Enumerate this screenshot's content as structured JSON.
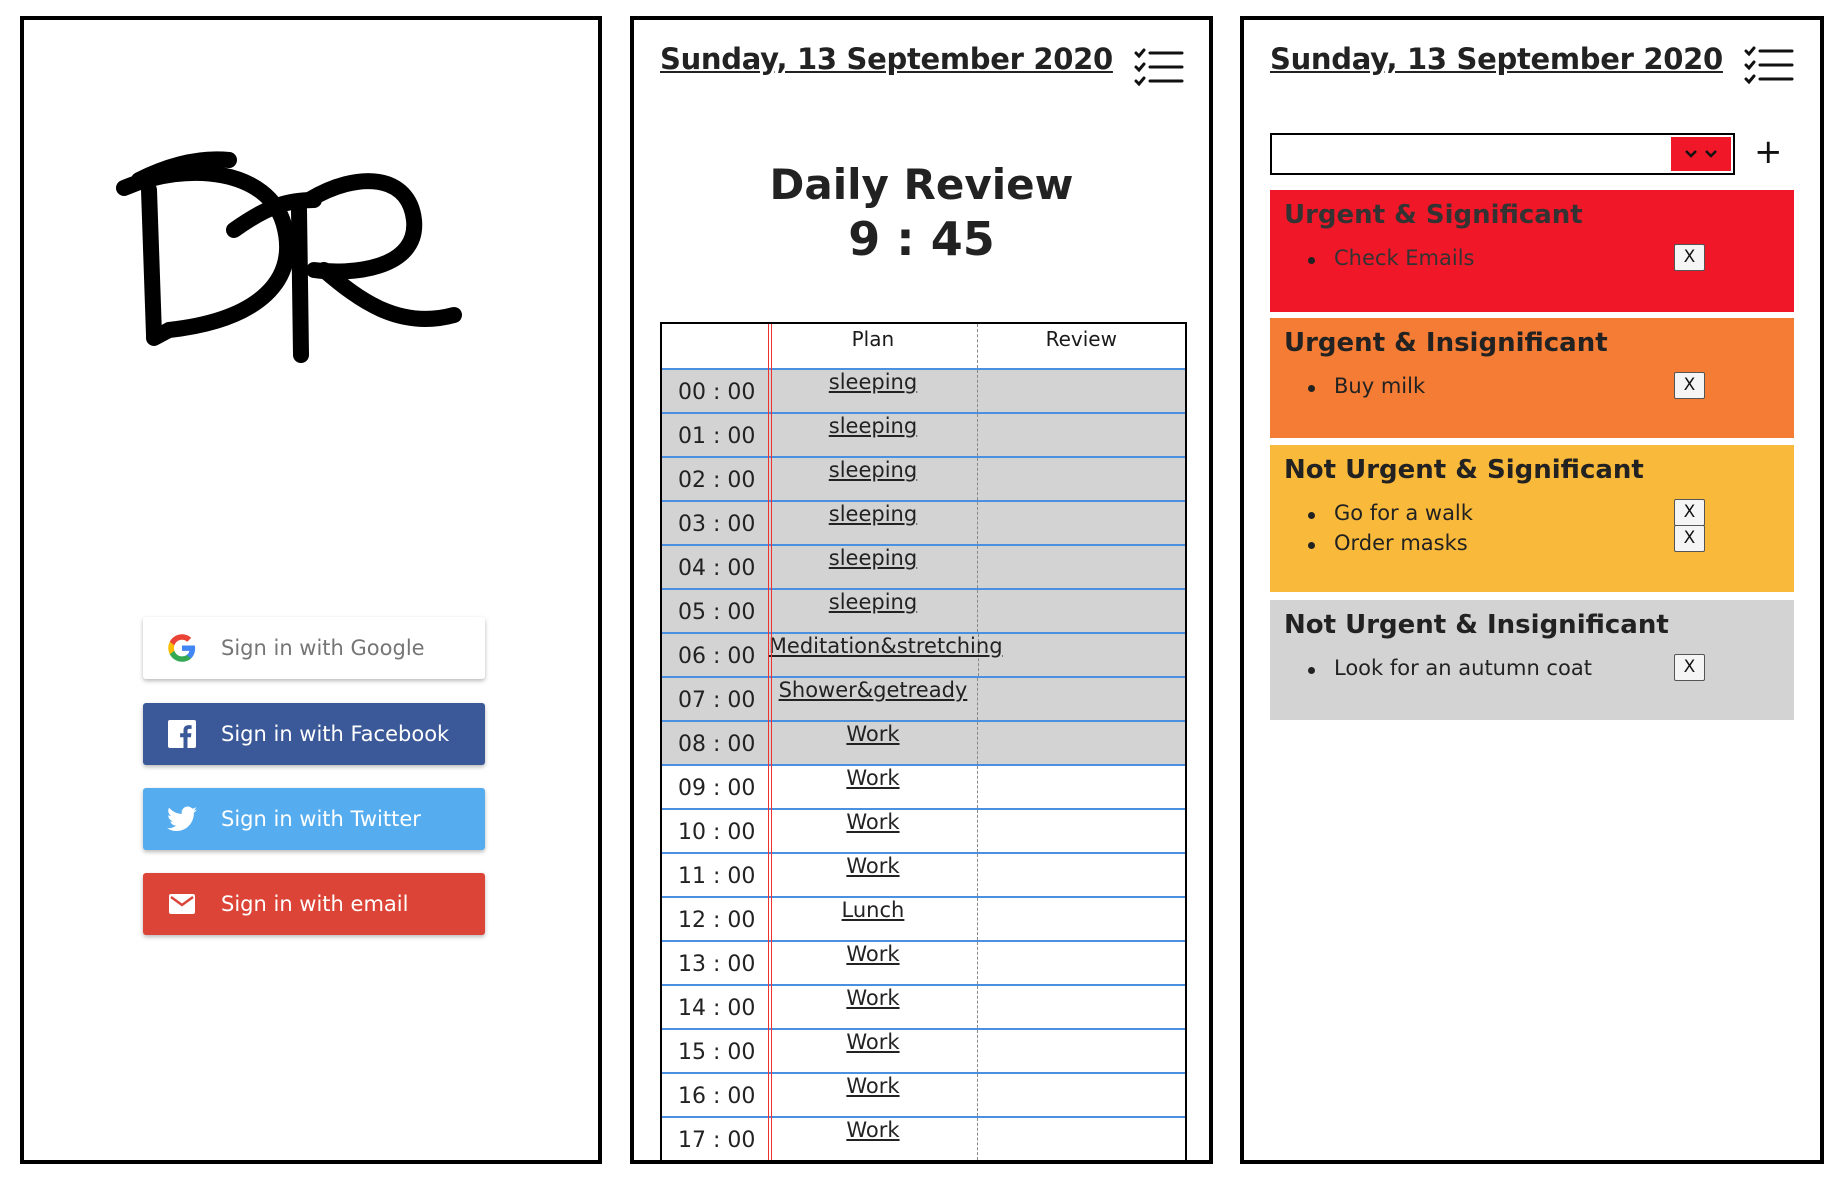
{
  "login": {
    "logo_text": "DR",
    "buttons": {
      "google": "Sign in with Google",
      "facebook": "Sign in with Facebook",
      "twitter": "Sign in with Twitter",
      "email": "Sign in with email"
    },
    "colors": {
      "google": "#ffffff",
      "facebook": "#3b5998",
      "twitter": "#55acee",
      "email": "#db4437"
    },
    "icons": [
      "google-icon",
      "facebook-icon",
      "twitter-icon",
      "email-icon"
    ]
  },
  "review": {
    "date": "Sunday, 13 September 2020",
    "heading": "Daily Review",
    "clock": "9 : 45",
    "columns": {
      "plan": "Plan",
      "review": "Review"
    },
    "rows": [
      {
        "time": "00 : 00",
        "plan": "sleeping",
        "review": "",
        "past": true
      },
      {
        "time": "01 : 00",
        "plan": "sleeping",
        "review": "",
        "past": true
      },
      {
        "time": "02 : 00",
        "plan": "sleeping",
        "review": "",
        "past": true
      },
      {
        "time": "03 : 00",
        "plan": "sleeping",
        "review": "",
        "past": true
      },
      {
        "time": "04 : 00",
        "plan": "sleeping",
        "review": "",
        "past": true
      },
      {
        "time": "05 : 00",
        "plan": "sleeping",
        "review": "",
        "past": true
      },
      {
        "time": "06 : 00",
        "plan": "Meditation&stretching",
        "review": "",
        "past": true
      },
      {
        "time": "07 : 00",
        "plan": "Shower&getready",
        "review": "",
        "past": true
      },
      {
        "time": "08 : 00",
        "plan": "Work",
        "review": "",
        "past": true
      },
      {
        "time": "09 : 00",
        "plan": "Work",
        "review": "",
        "past": false
      },
      {
        "time": "10 : 00",
        "plan": "Work",
        "review": "",
        "past": false
      },
      {
        "time": "11 : 00",
        "plan": "Work",
        "review": "",
        "past": false
      },
      {
        "time": "12 : 00",
        "plan": "Lunch",
        "review": "",
        "past": false
      },
      {
        "time": "13 : 00",
        "plan": "Work",
        "review": "",
        "past": false
      },
      {
        "time": "14 : 00",
        "plan": "Work",
        "review": "",
        "past": false
      },
      {
        "time": "15 : 00",
        "plan": "Work",
        "review": "",
        "past": false
      },
      {
        "time": "16 : 00",
        "plan": "Work",
        "review": "",
        "past": false
      },
      {
        "time": "17 : 00",
        "plan": "Work",
        "review": "",
        "past": false
      },
      {
        "time": "",
        "plan": "",
        "review": "",
        "past": false
      }
    ],
    "colors": {
      "past_row": "#d3d3d3",
      "row_line": "#4a8fe0",
      "now_line": "#e33333"
    },
    "menu_icon": "checklist-icon"
  },
  "tasks": {
    "date": "Sunday, 13 September 2020",
    "select_value": "",
    "add_label": "+",
    "remove_label": "X",
    "menu_icon": "checklist-icon",
    "quadrants": [
      {
        "title": "Urgent & Significant",
        "color": "#f01828",
        "items": [
          "Check Emails"
        ]
      },
      {
        "title": "Urgent & Insignificant",
        "color": "#f47c34",
        "items": [
          "Buy milk"
        ]
      },
      {
        "title": "Not Urgent & Significant",
        "color": "#f9b93b",
        "items": [
          "Go for a walk",
          "Order masks"
        ]
      },
      {
        "title": "Not Urgent & Insignificant",
        "color": "#d3d3d3",
        "items": [
          "Look for an autumn coat"
        ]
      }
    ]
  }
}
